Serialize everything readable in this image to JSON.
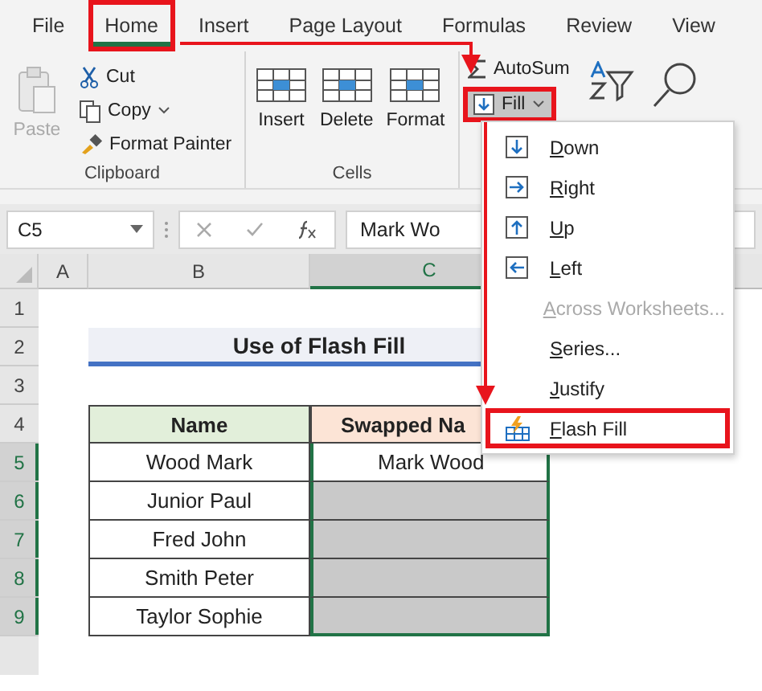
{
  "tabs": [
    {
      "label": "File",
      "selected": false,
      "annotated": false
    },
    {
      "label": "Home",
      "selected": true,
      "annotated": true
    },
    {
      "label": "Insert",
      "selected": false,
      "annotated": false
    },
    {
      "label": "Page Layout",
      "selected": false,
      "annotated": false
    },
    {
      "label": "Formulas",
      "selected": false,
      "annotated": false
    },
    {
      "label": "Review",
      "selected": false,
      "annotated": false
    },
    {
      "label": "View",
      "selected": false,
      "annotated": false
    }
  ],
  "ribbon": {
    "clipboard": {
      "name": "Clipboard",
      "paste": "Paste",
      "cut": "Cut",
      "copy": "Copy",
      "format_painter": "Format Painter"
    },
    "cells": {
      "name": "Cells",
      "buttons": [
        "Insert",
        "Delete",
        "Format"
      ]
    },
    "editing": {
      "autosum": "AutoSum",
      "fill": {
        "label": "Fill",
        "pressed": true,
        "annotated": true
      }
    }
  },
  "fill_menu": [
    {
      "label": "Down",
      "kind": "down",
      "disabled": false,
      "annotated": false
    },
    {
      "label": "Right",
      "kind": "right",
      "disabled": false,
      "annotated": false
    },
    {
      "label": "Up",
      "kind": "up",
      "disabled": false,
      "annotated": false
    },
    {
      "label": "Left",
      "kind": "left",
      "disabled": false,
      "annotated": false
    },
    {
      "label": "Across Worksheets...",
      "kind": "plain",
      "disabled": true,
      "annotated": false
    },
    {
      "label": "Series...",
      "kind": "plain",
      "disabled": false,
      "annotated": false
    },
    {
      "label": "Justify",
      "kind": "plain",
      "disabled": false,
      "annotated": false
    },
    {
      "label": "Flash Fill",
      "kind": "flash",
      "disabled": false,
      "annotated": true
    }
  ],
  "formula_bar": {
    "name_box": "C5",
    "formula": "Mark Wo"
  },
  "sheet": {
    "columns": [
      {
        "label": "A",
        "selected": false
      },
      {
        "label": "B",
        "selected": false
      },
      {
        "label": "C",
        "selected": true
      }
    ],
    "rows": [
      {
        "label": "1",
        "selected": false
      },
      {
        "label": "2",
        "selected": false
      },
      {
        "label": "3",
        "selected": false
      },
      {
        "label": "4",
        "selected": false
      },
      {
        "label": "5",
        "selected": true
      },
      {
        "label": "6",
        "selected": true
      },
      {
        "label": "7",
        "selected": true
      },
      {
        "label": "8",
        "selected": true
      },
      {
        "label": "9",
        "selected": true
      }
    ],
    "title": "Use of Flash Fill",
    "headers": [
      "Name",
      "Swapped Na"
    ],
    "data": [
      {
        "name": "Wood Mark",
        "swapped": "Mark Wood",
        "selected": false
      },
      {
        "name": "Junior Paul",
        "selected": true
      },
      {
        "name": "Fred John",
        "selected": true
      },
      {
        "name": "Smith Peter",
        "selected": true
      },
      {
        "name": "Taylor Sophie",
        "selected": true
      }
    ]
  }
}
